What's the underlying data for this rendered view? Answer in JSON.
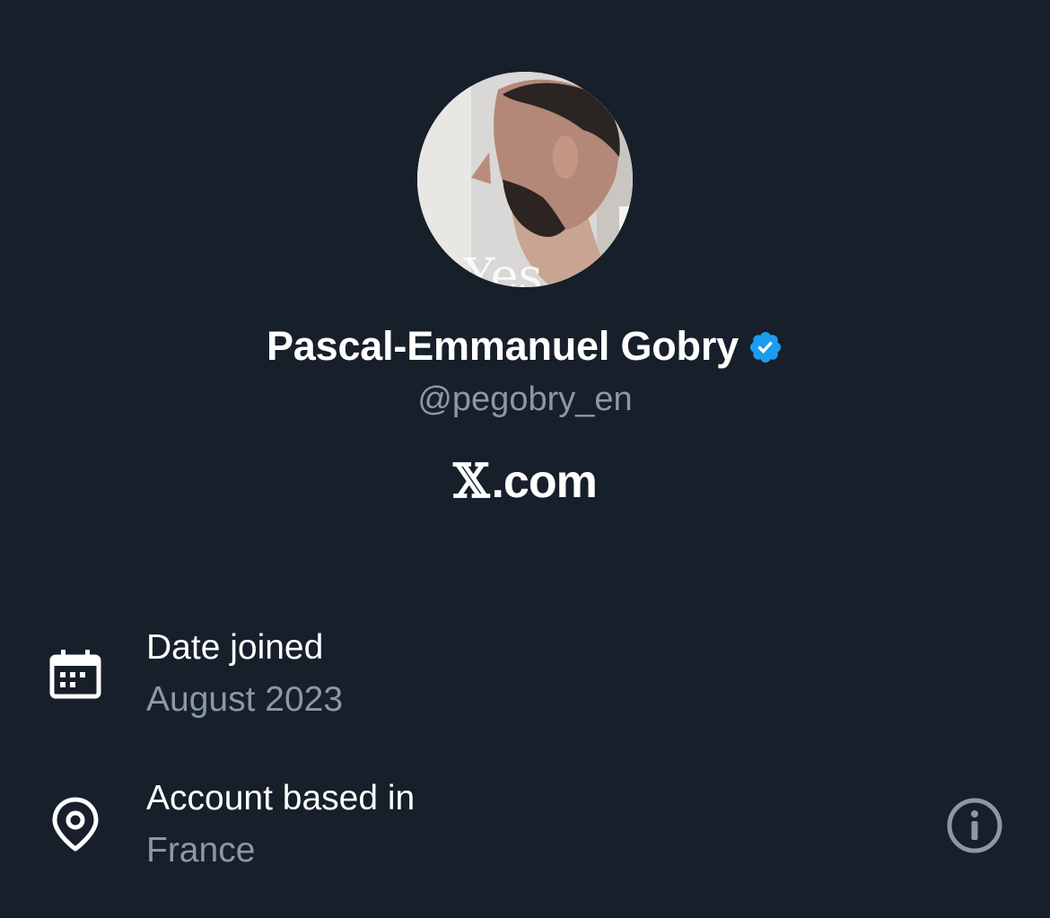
{
  "profile": {
    "display_name": "Pascal-Emmanuel Gobry",
    "handle": "@pegobry_en",
    "verified_icon": "verified-badge-icon",
    "avatar_description_icon": "profile-photo",
    "avatar_overlay_text": "Yes"
  },
  "brand": {
    "logo_glyph": "𝕏",
    "suffix": ".com"
  },
  "details": {
    "joined": {
      "icon": "calendar-icon",
      "label": "Date joined",
      "value": "August 2023"
    },
    "location": {
      "icon": "location-pin-icon",
      "label": "Account based in",
      "value": "France",
      "info_icon": "info-icon"
    }
  },
  "colors": {
    "background": "#161f2a",
    "primary_text": "#ffffff",
    "secondary_text": "#8b98a5",
    "verified_blue": "#1d9bf0"
  }
}
